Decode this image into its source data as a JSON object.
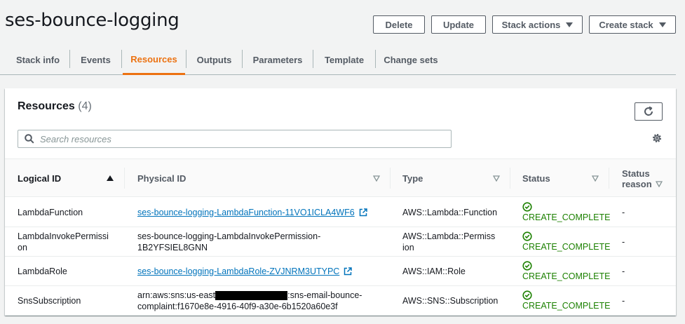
{
  "page": {
    "title": "ses-bounce-logging"
  },
  "actions": {
    "delete_label": "Delete",
    "update_label": "Update",
    "stack_actions_label": "Stack actions",
    "create_stack_label": "Create stack"
  },
  "tabs": [
    {
      "label": "Stack info",
      "active": false
    },
    {
      "label": "Events",
      "active": false
    },
    {
      "label": "Resources",
      "active": true
    },
    {
      "label": "Outputs",
      "active": false
    },
    {
      "label": "Parameters",
      "active": false
    },
    {
      "label": "Template",
      "active": false
    },
    {
      "label": "Change sets",
      "active": false
    }
  ],
  "resources": {
    "title": "Resources",
    "count": "(4)",
    "search_placeholder": "Search resources",
    "columns": [
      "Logical ID",
      "Physical ID",
      "Type",
      "Status",
      "Status reason"
    ],
    "rows": [
      {
        "logical_id": "LambdaFunction",
        "physical_id": "ses-bounce-logging-LambdaFunction-11VO1ICLA4WF6",
        "physical_is_link": true,
        "type": "AWS::Lambda::Function",
        "status": "CREATE_COMPLETE",
        "reason": "-"
      },
      {
        "logical_id": "LambdaInvokePermission",
        "physical_id": "ses-bounce-logging-LambdaInvokePermission-1B2YFSIEL8GNN",
        "physical_is_link": false,
        "type": "AWS::Lambda::Permission",
        "status": "CREATE_COMPLETE",
        "reason": "-"
      },
      {
        "logical_id": "LambdaRole",
        "physical_id": "ses-bounce-logging-LambdaRole-ZVJNRM3UTYPC",
        "physical_is_link": true,
        "type": "AWS::IAM::Role",
        "status": "CREATE_COMPLETE",
        "reason": "-"
      },
      {
        "logical_id": "SnsSubscription",
        "physical_id_prefix": "arn:aws:sns:us-east",
        "physical_id_suffix": ":sns-email-bounce-",
        "physical_id_line2": "complaint:f1670e8e-4916-40f9-a30e-6b1520a60e3f",
        "physical_is_link": false,
        "type": "AWS::SNS::Subscription",
        "status": "CREATE_COMPLETE",
        "reason": "-"
      }
    ]
  },
  "colors": {
    "accent": "#ec7211",
    "link": "#0073bb",
    "success": "#1d8102"
  },
  "icons": [
    "refresh-icon",
    "search-icon",
    "gear-icon",
    "external-link-icon",
    "status-success-icon",
    "sort-ascending-icon",
    "sort-descending-icon"
  ]
}
